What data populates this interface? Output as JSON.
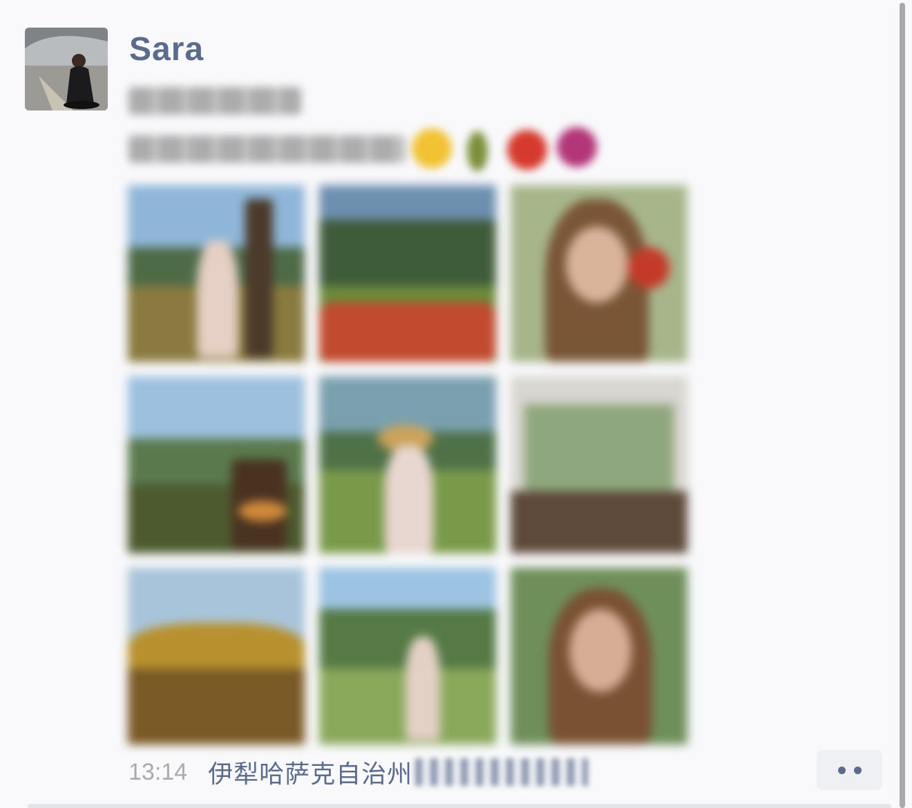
{
  "post": {
    "author": "Sara",
    "time": "13:14",
    "location": "伊犁哈萨克自治州",
    "photo_count": 9
  },
  "icons": {
    "more": "more-dots-icon"
  },
  "colors": {
    "name_link": "#5a6b8e",
    "time": "#aaaaaa",
    "background": "#f9f9fb"
  }
}
